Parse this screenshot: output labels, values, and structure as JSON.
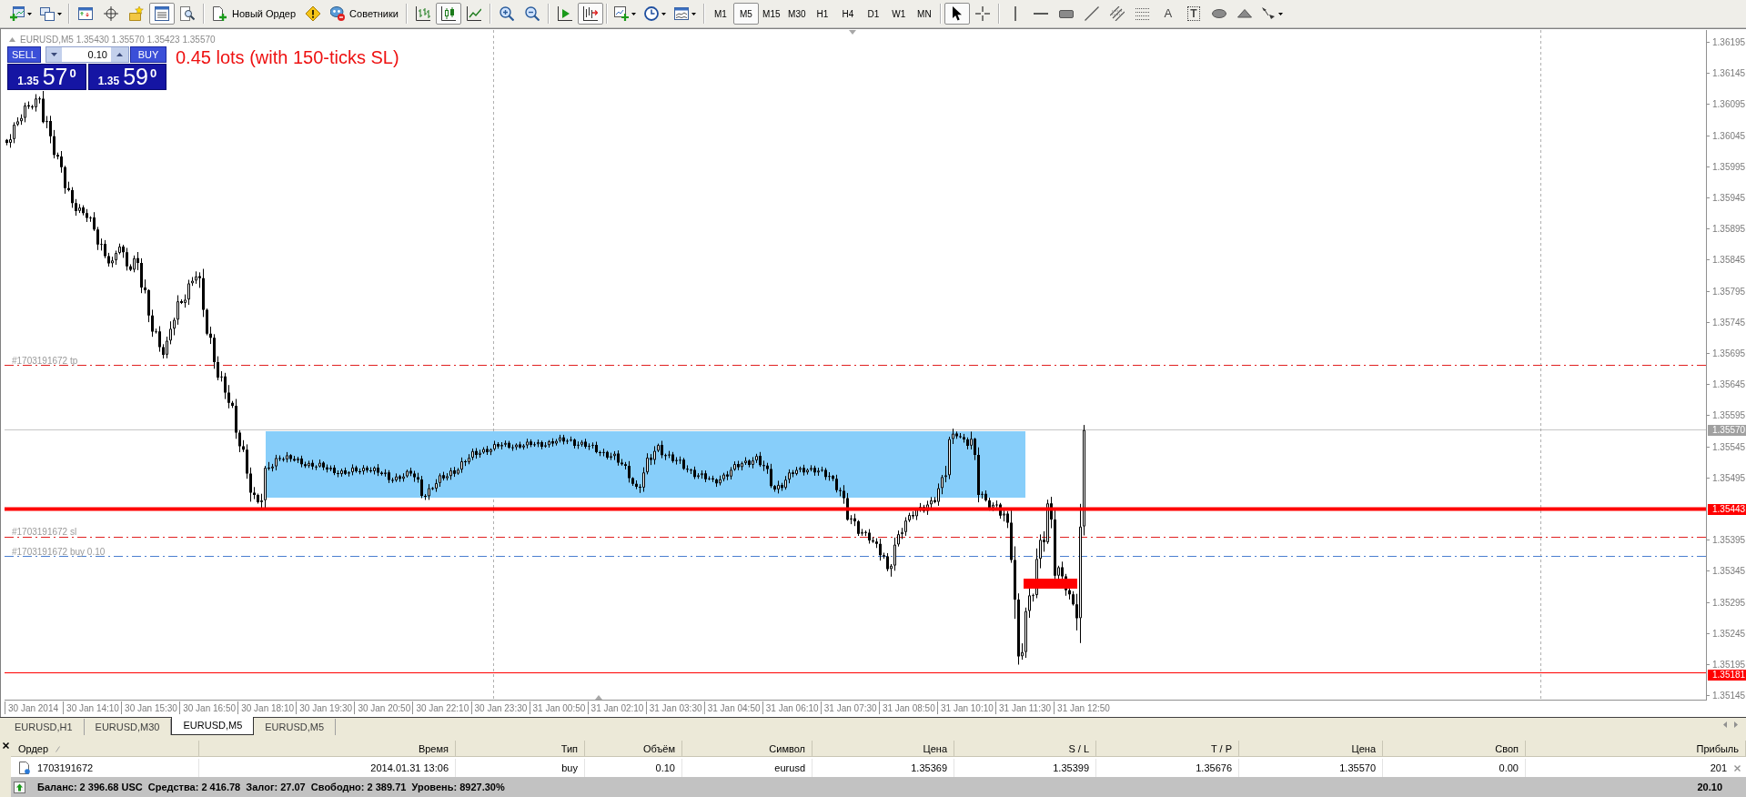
{
  "toolbar": {
    "view_toggles": [
      {
        "on": false
      },
      {
        "on": false
      },
      {
        "on": false
      },
      {
        "on": true
      },
      {
        "on": false
      }
    ],
    "new_order": "Новый Ордер",
    "expert_advisors": "Советники",
    "chart_types": [
      {
        "selected": false
      },
      {
        "selected": true
      },
      {
        "selected": false
      }
    ],
    "scroll_toggles": [
      {
        "on": false
      },
      {
        "on": true
      }
    ],
    "timeframes": [
      {
        "label": "M1",
        "selected": false
      },
      {
        "label": "M5",
        "selected": true
      },
      {
        "label": "M15",
        "selected": false
      },
      {
        "label": "M30",
        "selected": false
      },
      {
        "label": "H1",
        "selected": false
      },
      {
        "label": "H4",
        "selected": false
      },
      {
        "label": "D1",
        "selected": false
      },
      {
        "label": "W1",
        "selected": false
      },
      {
        "label": "MN",
        "selected": false
      }
    ],
    "cursor_modes": [
      {
        "selected": true
      },
      {
        "selected": false
      }
    ],
    "text_tools": [
      "A",
      "T"
    ]
  },
  "chart": {
    "info": "EURUSD,M5 1.35430 1.35570 1.35423 1.35570",
    "one_click": {
      "sell": "SELL",
      "buy": "BUY",
      "volume": "0.10",
      "sell_price": {
        "prefix": "1.35",
        "digits": "57",
        "point": "0"
      },
      "buy_price": {
        "prefix": "1.35",
        "digits": "59",
        "point": "0"
      }
    },
    "comment": "0.45 lots (with 150-ticks SL)",
    "order_lines": [
      {
        "kind": "tp",
        "label": "#1703191672 tp"
      },
      {
        "kind": "sl",
        "label": "#1703191672 sl"
      },
      {
        "kind": "buy",
        "label": "#1703191672 buy 0.10"
      }
    ],
    "price_axis": [
      "1.36195",
      "1.36145",
      "1.36095",
      "1.36045",
      "1.35995",
      "1.35945",
      "1.35895",
      "1.35845",
      "1.35795",
      "1.35745",
      "1.35695",
      "1.35645",
      "1.35595",
      "1.35545",
      "1.35495",
      "1.35395",
      "1.35345",
      "1.35295",
      "1.35245",
      "1.35195",
      "1.35145"
    ],
    "price_tags": [
      {
        "text": "1.35570",
        "color": "#a0a0a0"
      },
      {
        "text": "1.35443",
        "color": "#ff0000"
      },
      {
        "text": "1.35181",
        "color": "#ff0000"
      }
    ],
    "time_axis": [
      "30 Jan 2014",
      "30 Jan 14:10",
      "30 Jan 15:30",
      "30 Jan 16:50",
      "30 Jan 18:10",
      "30 Jan 19:30",
      "30 Jan 20:50",
      "30 Jan 22:10",
      "30 Jan 23:30",
      "31 Jan 00:50",
      "31 Jan 02:10",
      "31 Jan 03:30",
      "31 Jan 04:50",
      "31 Jan 06:10",
      "31 Jan 07:30",
      "31 Jan 08:50",
      "31 Jan 10:10",
      "31 Jan 11:30",
      "31 Jan 12:50"
    ]
  },
  "chart_tabs": [
    {
      "label": "EURUSD,H1",
      "selected": false
    },
    {
      "label": "EURUSD,M30",
      "selected": false
    },
    {
      "label": "EURUSD,M5",
      "selected": true
    },
    {
      "label": "EURUSD,M5",
      "selected": false
    }
  ],
  "terminal": {
    "columns": [
      "Ордер",
      "Время",
      "Тип",
      "Объём",
      "Символ",
      "Цена",
      "S / L",
      "T / P",
      "Цена",
      "Своп",
      "Прибыль"
    ],
    "rows": [
      {
        "cells": [
          "1703191672",
          "2014.01.31 13:06",
          "buy",
          "0.10",
          "eurusd",
          "1.35369",
          "1.35399",
          "1.35676",
          "1.35570",
          "0.00",
          "201"
        ]
      }
    ],
    "summary": "Баланс: 2 396.68 USC  Средства: 2 416.78  Залог: 27.07  Свободно: 2 389.71  Уровень: 8927.30%",
    "total": "20.10"
  }
}
